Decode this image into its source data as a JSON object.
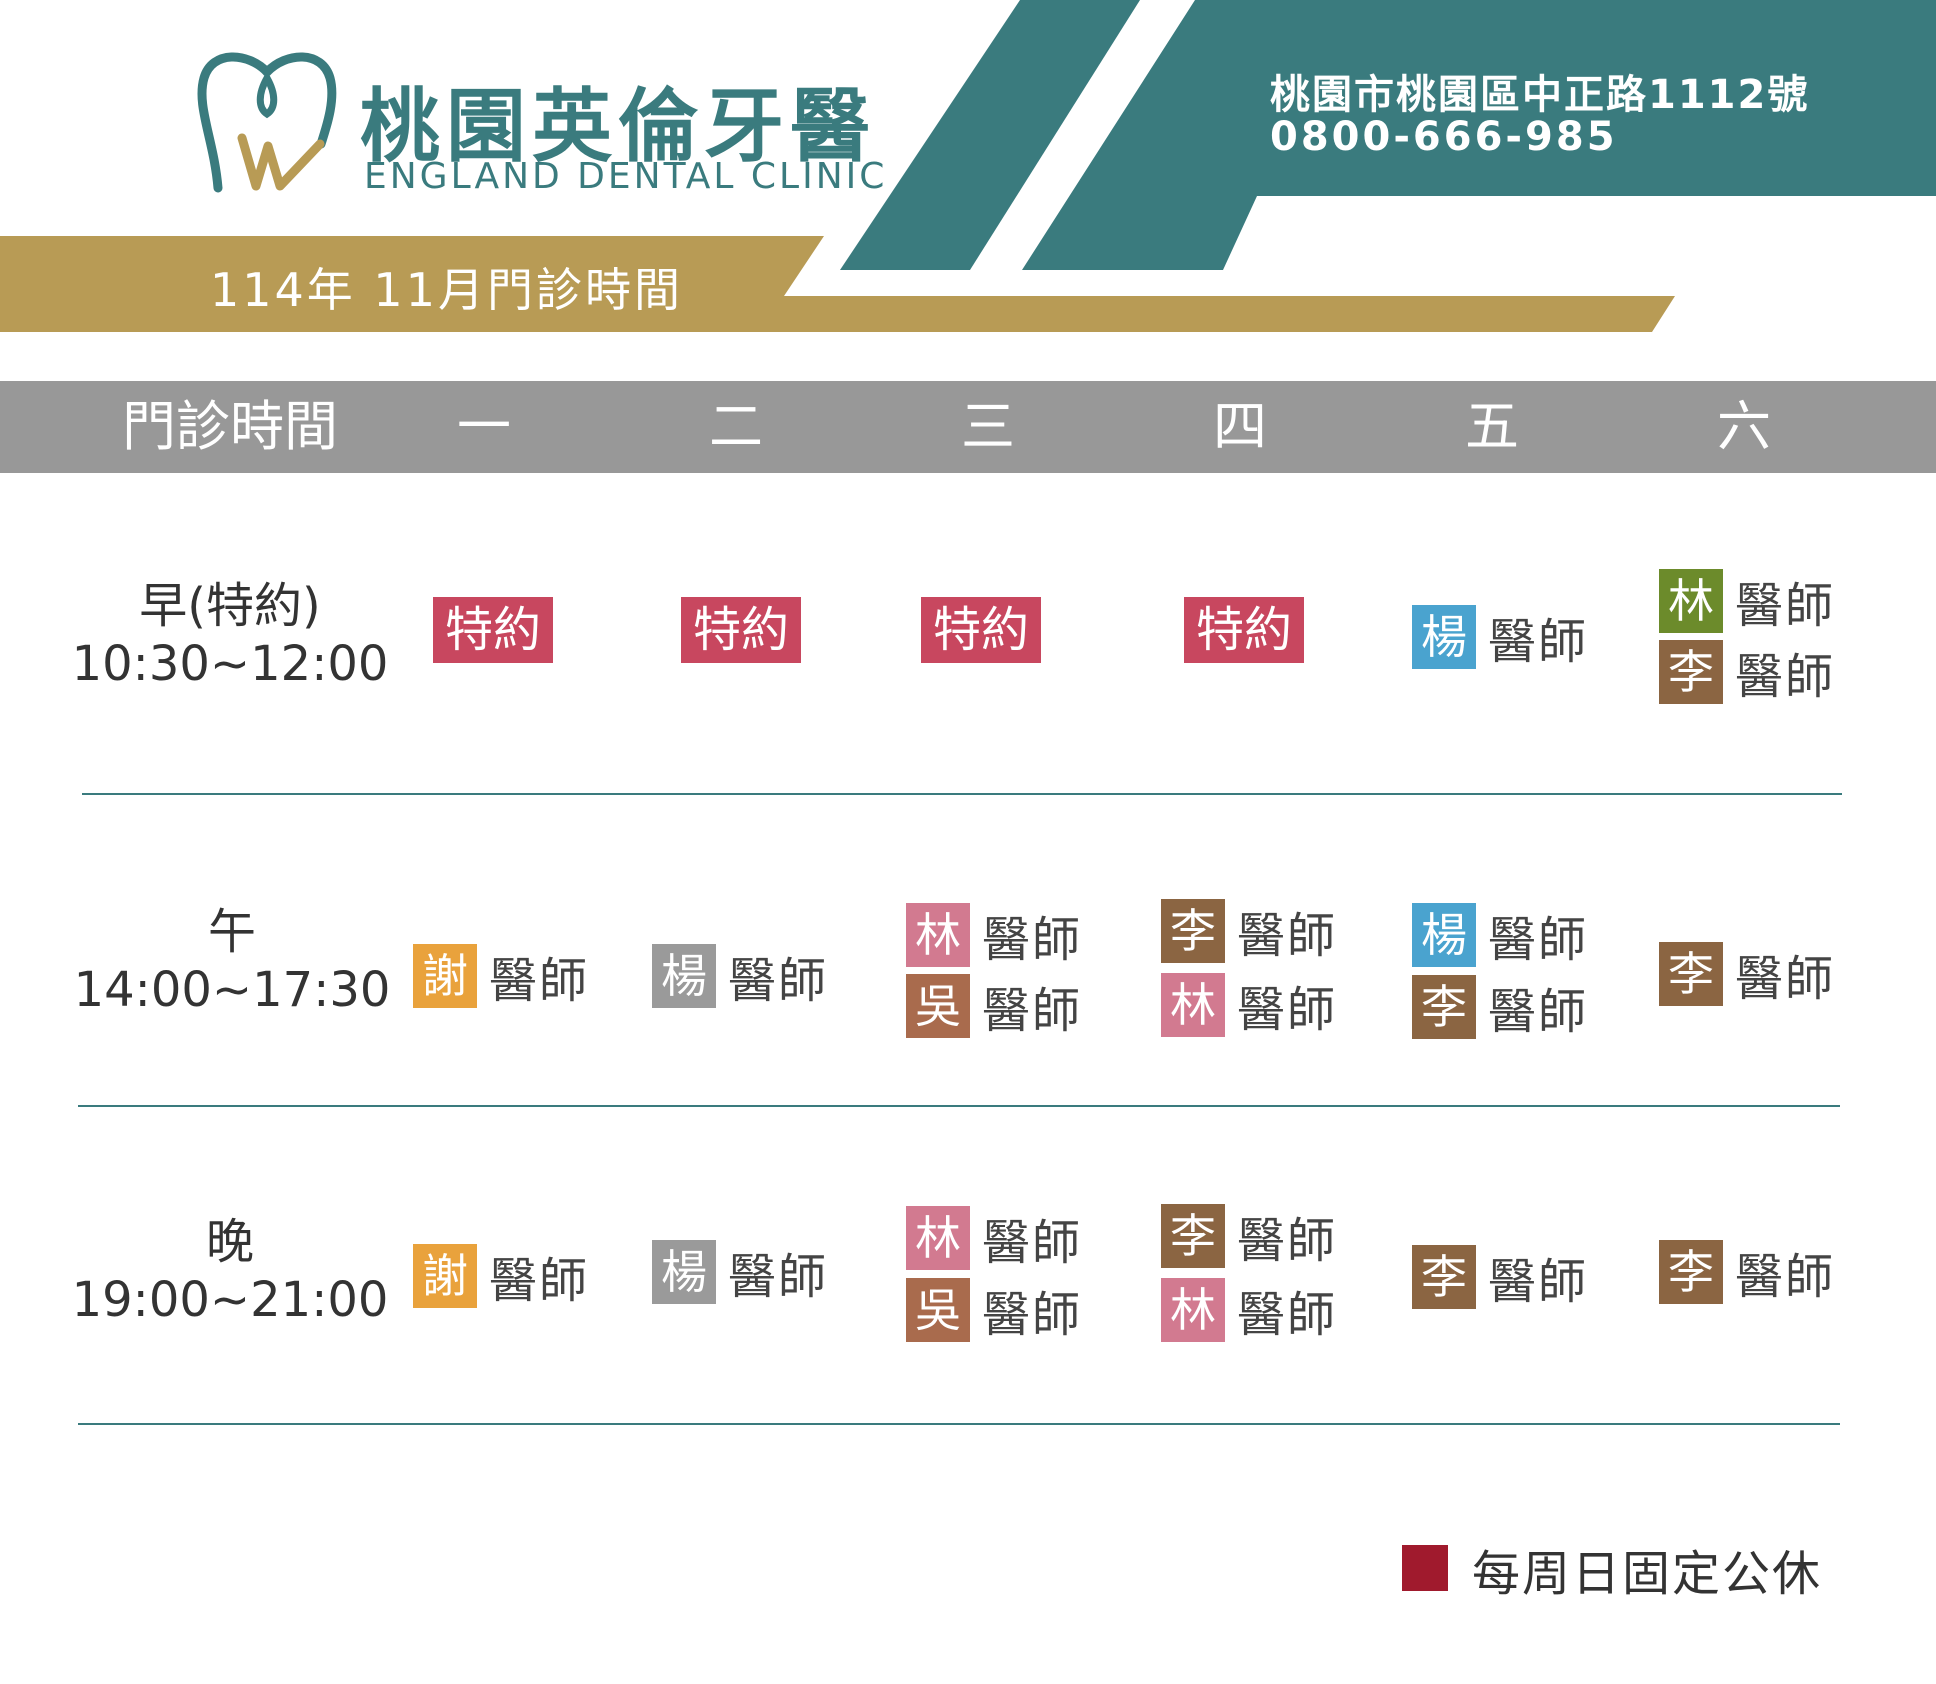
{
  "clinic": {
    "name_cn": "桃園英倫牙醫",
    "name_en": "ENGLAND DENTAL CLINIC",
    "address": "桃園市桃園區中正路1112號",
    "phone": "0800-666-985",
    "month_title": "114年 11月門診時間",
    "brand_colors": {
      "teal": "#3a7b7e",
      "gold": "#b89b55",
      "gray": "#989898"
    }
  },
  "header": {
    "time_col": "門診時間",
    "days": [
      "一",
      "二",
      "三",
      "四",
      "五",
      "六"
    ]
  },
  "schedule": {
    "morning": {
      "name": "早(特約)",
      "time": "10:30~12:00",
      "mon": [
        {
          "type": "special",
          "label": "特約"
        }
      ],
      "tue": [
        {
          "type": "special",
          "label": "特約"
        }
      ],
      "wed": [
        {
          "type": "special",
          "label": "特約"
        }
      ],
      "thu": [
        {
          "type": "special",
          "label": "特約"
        }
      ],
      "fri": [
        {
          "surname": "楊",
          "suffix": "醫師",
          "color": "#4aa3cf"
        }
      ],
      "sat": [
        {
          "surname": "林",
          "suffix": "醫師",
          "color": "#6c8b2b"
        },
        {
          "surname": "李",
          "suffix": "醫師",
          "color": "#8b6542"
        }
      ]
    },
    "afternoon": {
      "name": "午",
      "time": "14:00~17:30",
      "mon": [
        {
          "surname": "謝",
          "suffix": "醫師",
          "color": "#e9a23c"
        }
      ],
      "tue": [
        {
          "surname": "楊",
          "suffix": "醫師",
          "color": "#9a9a9a"
        }
      ],
      "wed": [
        {
          "surname": "林",
          "suffix": "醫師",
          "color": "#d27a90"
        },
        {
          "surname": "吳",
          "suffix": "醫師",
          "color": "#a96b4d"
        }
      ],
      "thu": [
        {
          "surname": "李",
          "suffix": "醫師",
          "color": "#8b6542"
        },
        {
          "surname": "林",
          "suffix": "醫師",
          "color": "#d27a90"
        }
      ],
      "fri": [
        {
          "surname": "楊",
          "suffix": "醫師",
          "color": "#4aa3cf"
        },
        {
          "surname": "李",
          "suffix": "醫師",
          "color": "#8b6542"
        }
      ],
      "sat": [
        {
          "surname": "李",
          "suffix": "醫師",
          "color": "#8b6542"
        }
      ]
    },
    "evening": {
      "name": "晚",
      "time": "19:00~21:00",
      "mon": [
        {
          "surname": "謝",
          "suffix": "醫師",
          "color": "#e9a23c"
        }
      ],
      "tue": [
        {
          "surname": "楊",
          "suffix": "醫師",
          "color": "#9a9a9a"
        }
      ],
      "wed": [
        {
          "surname": "林",
          "suffix": "醫師",
          "color": "#d27a90"
        },
        {
          "surname": "吳",
          "suffix": "醫師",
          "color": "#a96b4d"
        }
      ],
      "thu": [
        {
          "surname": "李",
          "suffix": "醫師",
          "color": "#8b6542"
        },
        {
          "surname": "林",
          "suffix": "醫師",
          "color": "#d27a90"
        }
      ],
      "fri": [
        {
          "surname": "李",
          "suffix": "醫師",
          "color": "#8b6542"
        }
      ],
      "sat": [
        {
          "surname": "李",
          "suffix": "醫師",
          "color": "#8b6542"
        }
      ]
    }
  },
  "legend": {
    "text": "每周日固定公休",
    "color": "#a01a2d"
  }
}
